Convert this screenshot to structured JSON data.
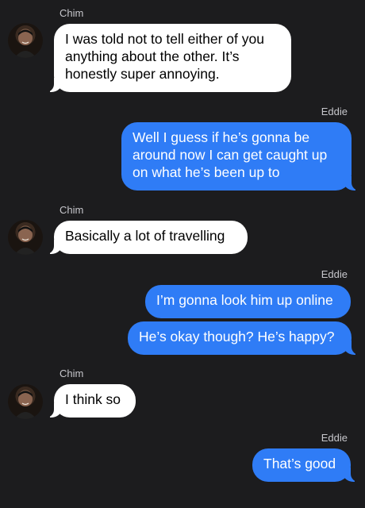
{
  "messages": [
    {
      "sender": "Chim",
      "text": "I was told not to tell either of you anything about the other. It’s honestly super annoying."
    },
    {
      "sender": "Eddie",
      "text": "Well I guess if he’s gonna be around now I can get caught up on what he’s been up to"
    },
    {
      "sender": "Chim",
      "text": "Basically a lot of travelling"
    },
    {
      "sender": "Eddie",
      "text": "I’m gonna look him up online"
    },
    {
      "sender": "Eddie",
      "text": "He’s okay though? He’s happy?"
    },
    {
      "sender": "Chim",
      "text": "I think so"
    },
    {
      "sender": "Eddie",
      "text": "That’s good"
    }
  ],
  "icons": {
    "avatar": "contact-avatar-photo"
  },
  "colors": {
    "background": "#1c1c1e",
    "incoming": "#ffffff",
    "outgoing": "#2f7cf6"
  }
}
